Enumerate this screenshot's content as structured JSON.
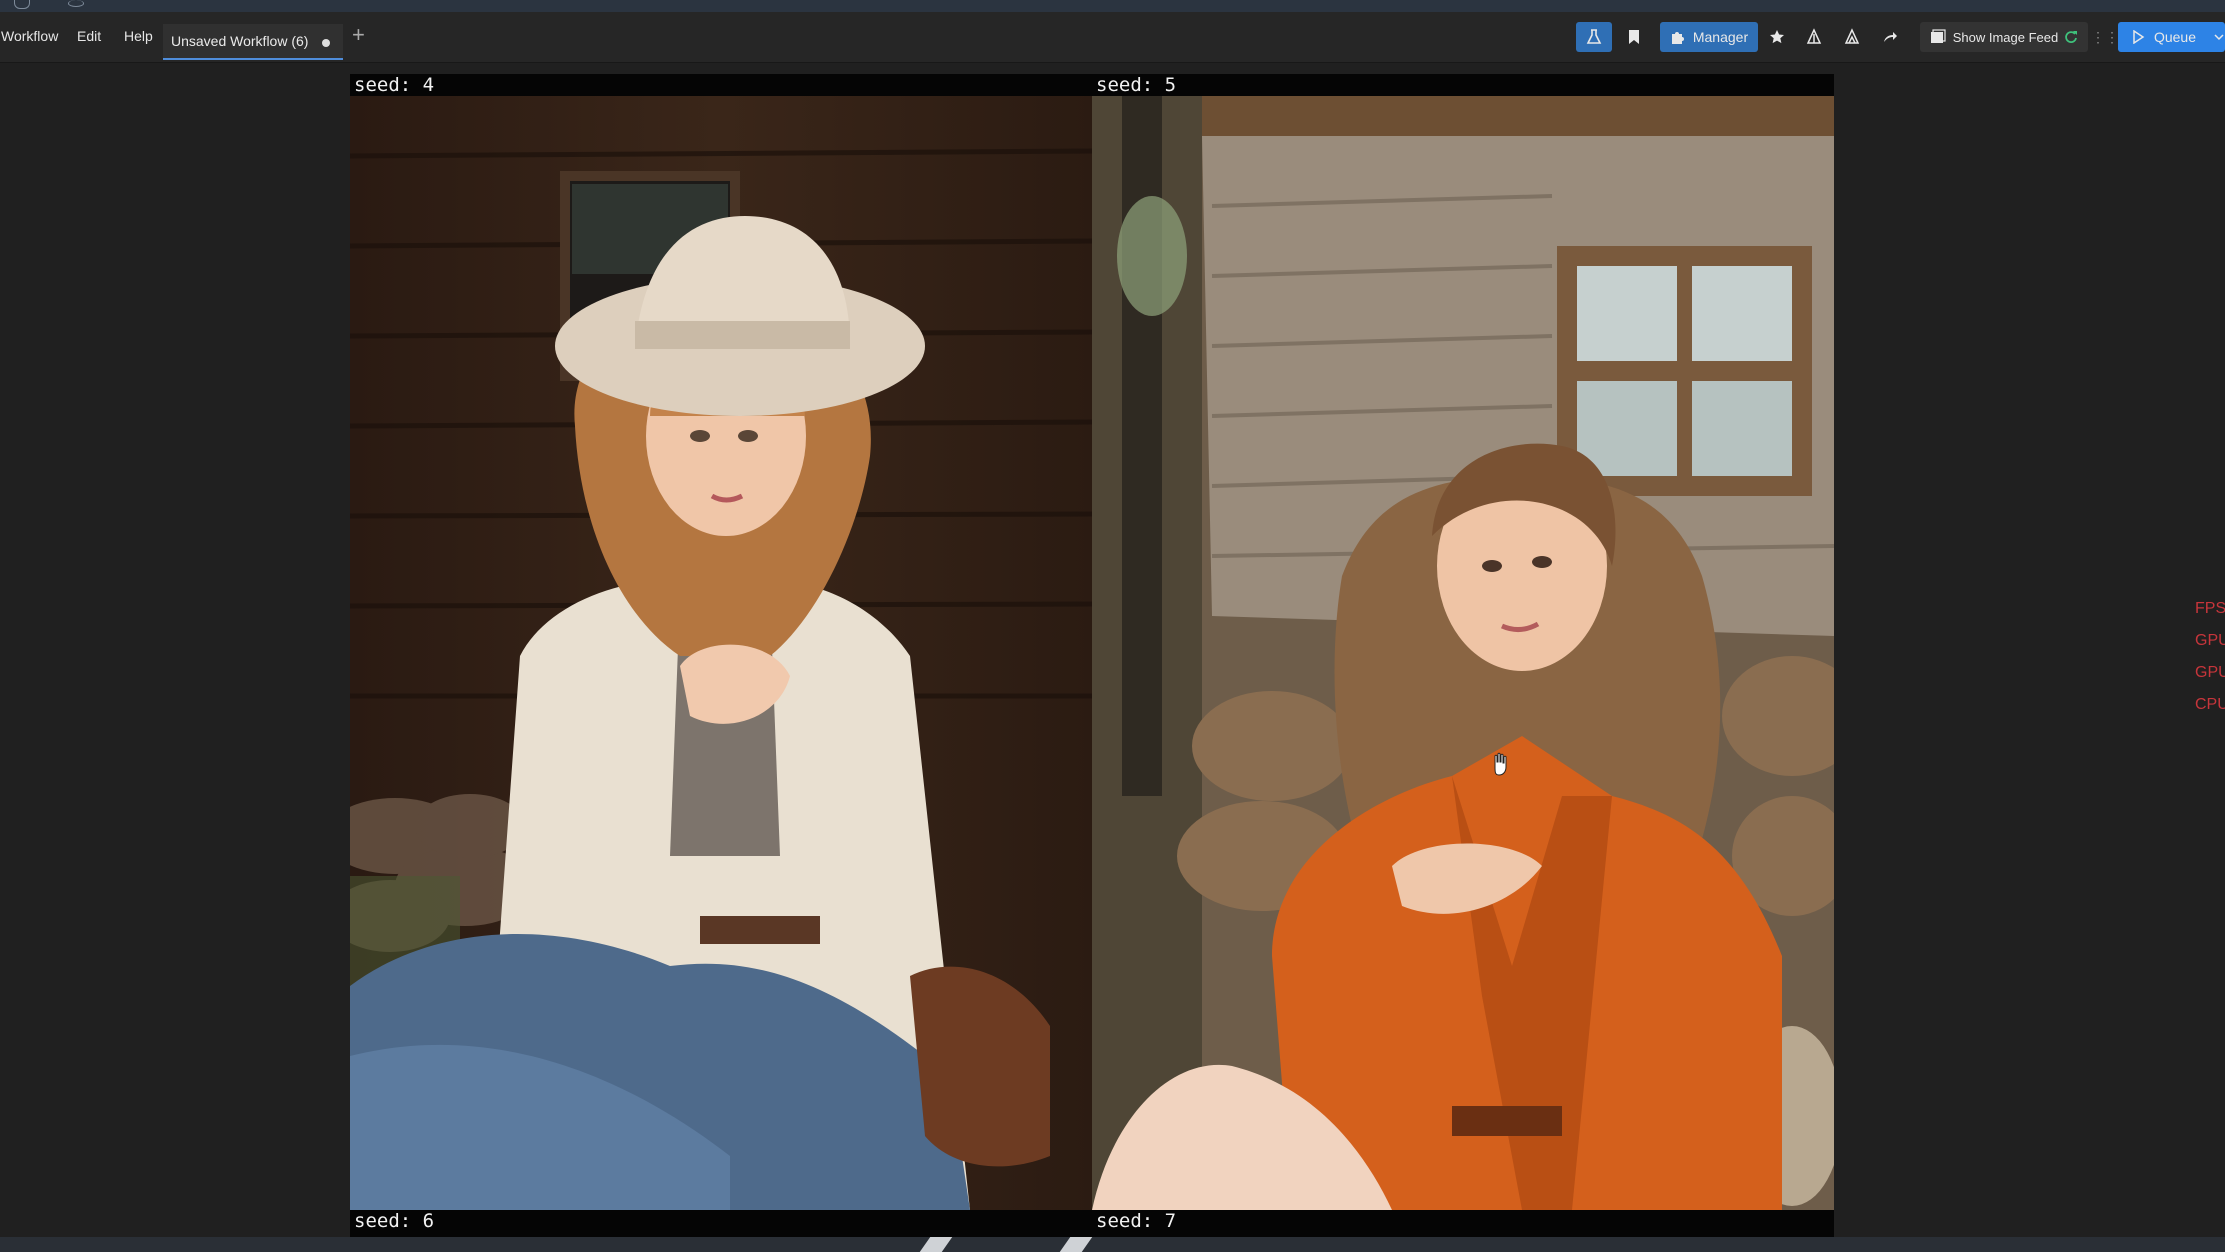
{
  "menu": {
    "workflow": "Workflow",
    "edit": "Edit",
    "help": "Help"
  },
  "tab": {
    "title": "Unsaved Workflow (6)"
  },
  "toolbar": {
    "manager_label": "Manager",
    "image_feed_label": "Show Image Feed",
    "queue_label": "Queue"
  },
  "grid": {
    "cells": [
      {
        "seed_label": "seed: 4"
      },
      {
        "seed_label": "seed: 5"
      },
      {
        "seed_label": "seed: 6"
      },
      {
        "seed_label": "seed: 7"
      }
    ]
  },
  "side_stats": [
    "FPS",
    "GPU",
    "GPU",
    "CPU"
  ],
  "colors": {
    "accent_blue": "#2d83e6",
    "manager_blue": "#2f6fb5",
    "stats_red": "#c7353b"
  },
  "icons": [
    "flask-icon",
    "bookmark-icon",
    "puzzle-icon",
    "star-icon",
    "tree-icon",
    "tree-alt-icon",
    "share-icon",
    "image-icon",
    "refresh-icon",
    "drag-handle-icon",
    "play-icon",
    "chevron-down-icon"
  ]
}
